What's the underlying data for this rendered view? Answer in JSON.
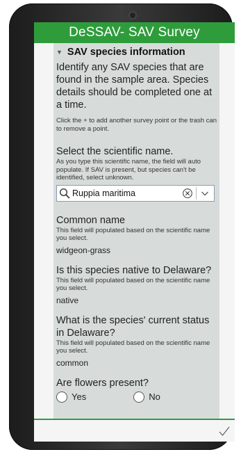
{
  "app": {
    "title": "DeSSAV- SAV Survey"
  },
  "section": {
    "title": "SAV species information",
    "description": "Identify any SAV species that are found in the sample area. Species details should be completed one at a time.",
    "hint": "Click the + to add another survey point or the trash can to remove a point."
  },
  "scientific_name": {
    "label": "Select the scientific name.",
    "hint": "As you type this scientific name, the field will auto populate. If SAV is present, but species can't be identified, select unknown.",
    "value": "Ruppia maritima"
  },
  "common_name": {
    "label": "Common name",
    "hint": "This field will populated based on the scientific name you select.",
    "value": "widgeon-grass"
  },
  "native": {
    "label": "Is this species native to Delaware?",
    "hint": "This field will populated based on the scientific name you select.",
    "value": "native"
  },
  "status": {
    "label": "What is the species' current status in Delaware?",
    "hint": "This field will populated based on the scientific name you select.",
    "value": "common"
  },
  "flowers": {
    "label": "Are flowers present?",
    "options": [
      "Yes",
      "No"
    ]
  },
  "colors": {
    "brand": "#2f9c3c",
    "form_background": "#d7dcdb"
  },
  "icons": {
    "collapse": "caret-down-icon",
    "search": "magnifier-icon",
    "clear": "circle-x-icon",
    "dropdown": "chevron-down-icon",
    "submit": "checkmark-icon"
  }
}
